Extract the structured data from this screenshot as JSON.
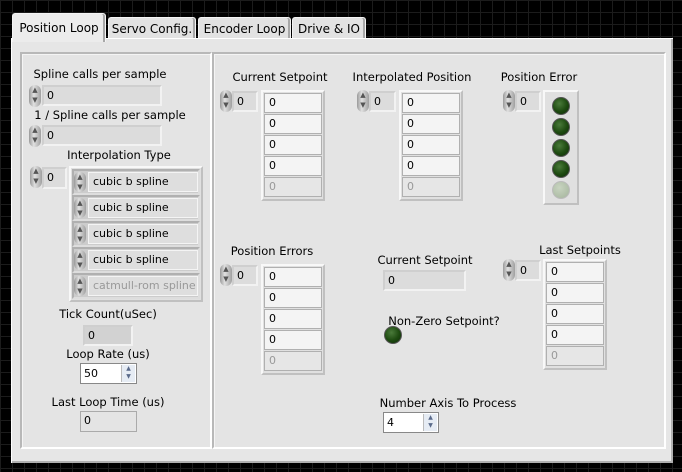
{
  "tabs": [
    "Position Loop",
    "Servo Config.",
    "Encoder Loop",
    "Drive & IO"
  ],
  "left": {
    "spline_calls": {
      "label": "Spline calls per sample",
      "value": "0"
    },
    "inv_spline_calls": {
      "label": "1 / Spline calls per sample",
      "value": "0"
    },
    "interp_type": {
      "label": "Interpolation Type",
      "index": "0",
      "items": [
        "cubic b spline",
        "cubic b spline",
        "cubic b spline",
        "cubic b spline",
        "catmull-rom spline"
      ]
    },
    "tick_count": {
      "label": "Tick Count(uSec)",
      "value": "0"
    },
    "loop_rate": {
      "label": "Loop Rate (us)",
      "value": "50"
    },
    "last_loop_time": {
      "label": "Last Loop Time (us)",
      "value": "0"
    }
  },
  "right": {
    "current_setpoint_array": {
      "label": "Current Setpoint",
      "index": "0",
      "items": [
        "0",
        "0",
        "0",
        "0",
        "0"
      ]
    },
    "interpolated_position": {
      "label": "Interpolated Position",
      "index": "0",
      "items": [
        "0",
        "0",
        "0",
        "0",
        "0"
      ]
    },
    "position_error": {
      "label": "Position Error",
      "index": "0",
      "leds": [
        true,
        true,
        true,
        true,
        false
      ]
    },
    "position_errors": {
      "label": "Position Errors",
      "index": "0",
      "items": [
        "0",
        "0",
        "0",
        "0",
        "0"
      ]
    },
    "current_setpoint": {
      "label": "Current Setpoint",
      "value": "0"
    },
    "non_zero_setpoint": {
      "label": "Non-Zero Setpoint?"
    },
    "last_setpoints": {
      "label": "Last Setpoints",
      "index": "0",
      "items": [
        "0",
        "0",
        "0",
        "0",
        "0"
      ]
    },
    "number_axis": {
      "label": "Number Axis To Process",
      "value": "4"
    }
  }
}
